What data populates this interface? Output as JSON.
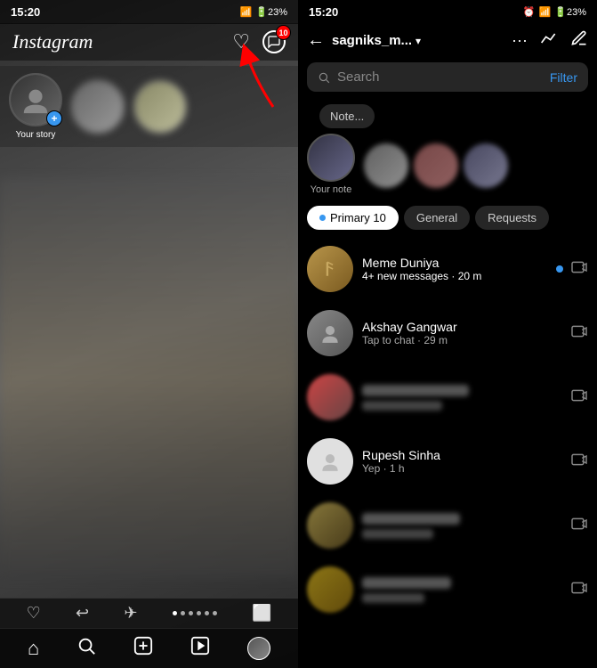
{
  "left": {
    "status_time": "15:20",
    "status_icons": "📶 🔋23%",
    "logo": "Instagram",
    "header_icons": {
      "heart": "♡",
      "messenger": "✉",
      "badge": "10"
    },
    "your_story_label": "Your story",
    "nav_bottom_icons": [
      "♡",
      "↩",
      "✈",
      "⋯⋯",
      "⬜"
    ],
    "nav_main_icons": [
      "⌂",
      "🔍",
      "⊕",
      "▷"
    ]
  },
  "right": {
    "status_time": "15:20",
    "username": "sagniks_m...",
    "search_placeholder": "Search",
    "filter_label": "Filter",
    "note_text": "Note...",
    "your_note_label": "Your note",
    "tabs": [
      {
        "id": "primary",
        "label": "Primary 10",
        "active": true,
        "has_dot": true
      },
      {
        "id": "general",
        "label": "General",
        "active": false,
        "has_dot": false
      },
      {
        "id": "requests",
        "label": "Requests",
        "active": false,
        "has_dot": false
      }
    ],
    "chats": [
      {
        "id": "meme-duniya",
        "name": "Meme Duniya",
        "sub": "4+ new messages · 20 m",
        "new_messages": true,
        "unread_dot": true
      },
      {
        "id": "akshay",
        "name": "Akshay Gangwar",
        "sub": "Tap to chat · 29 m",
        "new_messages": false,
        "unread_dot": false
      },
      {
        "id": "blurred1",
        "name": "",
        "sub": "",
        "new_messages": false,
        "unread_dot": false
      },
      {
        "id": "rupesh",
        "name": "Rupesh Sinha",
        "sub": "Yep · 1 h",
        "new_messages": false,
        "unread_dot": false
      },
      {
        "id": "blurred2",
        "name": "",
        "sub": "",
        "new_messages": false,
        "unread_dot": false
      },
      {
        "id": "blurred3",
        "name": "",
        "sub": "",
        "new_messages": false,
        "unread_dot": false
      }
    ]
  }
}
